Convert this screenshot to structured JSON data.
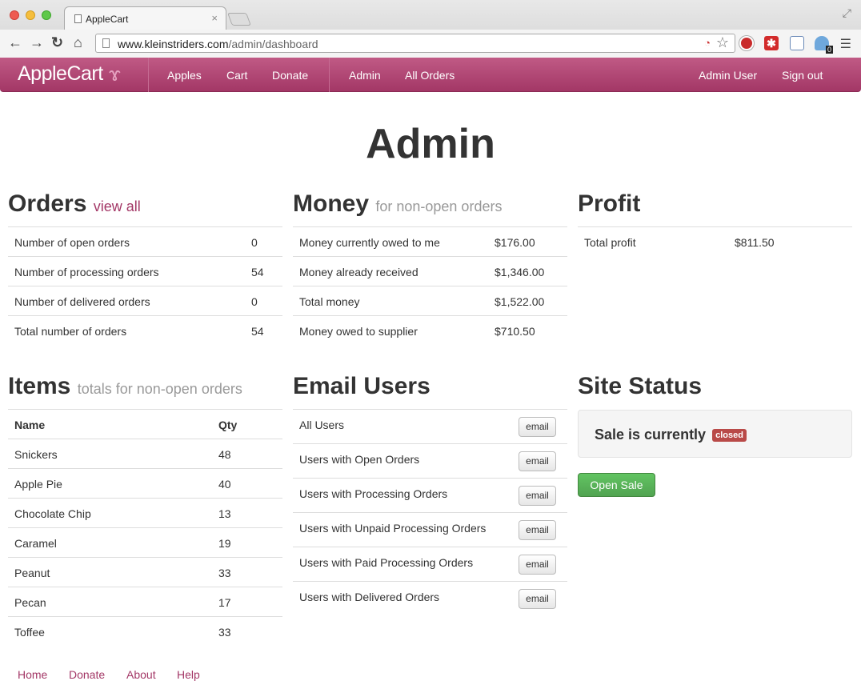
{
  "browser": {
    "tab_title": "AppleCart",
    "tab_close": "×",
    "url_host": "www.kleinstriders.com",
    "url_path": "/admin/dashboard",
    "extension_badge": "0"
  },
  "navbar": {
    "brand": "AppleCart",
    "links": [
      "Apples",
      "Cart",
      "Donate",
      "Admin",
      "All Orders"
    ],
    "user": "Admin User",
    "signout": "Sign out"
  },
  "page_title": "Admin",
  "orders": {
    "title": "Orders",
    "link": "view all",
    "rows": [
      {
        "label": "Number of open orders",
        "value": "0"
      },
      {
        "label": "Number of processing orders",
        "value": "54"
      },
      {
        "label": "Number of delivered orders",
        "value": "0"
      },
      {
        "label": "Total number of orders",
        "value": "54"
      }
    ]
  },
  "money": {
    "title": "Money",
    "subtitle": "for non-open orders",
    "rows": [
      {
        "label": "Money currently owed to me",
        "value": "$176.00"
      },
      {
        "label": "Money already received",
        "value": "$1,346.00"
      },
      {
        "label": "Total money",
        "value": "$1,522.00"
      },
      {
        "label": "Money owed to supplier",
        "value": "$710.50"
      }
    ]
  },
  "profit": {
    "title": "Profit",
    "rows": [
      {
        "label": "Total profit",
        "value": "$811.50"
      }
    ]
  },
  "items": {
    "title": "Items",
    "subtitle": "totals for non-open orders",
    "headers": {
      "name": "Name",
      "qty": "Qty"
    },
    "rows": [
      {
        "name": "Snickers",
        "qty": "48"
      },
      {
        "name": "Apple Pie",
        "qty": "40"
      },
      {
        "name": "Chocolate Chip",
        "qty": "13"
      },
      {
        "name": "Caramel",
        "qty": "19"
      },
      {
        "name": "Peanut",
        "qty": "33"
      },
      {
        "name": "Pecan",
        "qty": "17"
      },
      {
        "name": "Toffee",
        "qty": "33"
      }
    ]
  },
  "email_users": {
    "title": "Email Users",
    "button_label": "email",
    "rows": [
      "All Users",
      "Users with Open Orders",
      "Users with Processing Orders",
      "Users with Unpaid Processing Orders",
      "Users with Paid Processing Orders",
      "Users with Delivered Orders"
    ]
  },
  "site_status": {
    "title": "Site Status",
    "text": "Sale is currently",
    "badge": "closed",
    "button": "Open Sale"
  },
  "footer": {
    "links": [
      "Home",
      "Donate",
      "About",
      "Help"
    ]
  }
}
